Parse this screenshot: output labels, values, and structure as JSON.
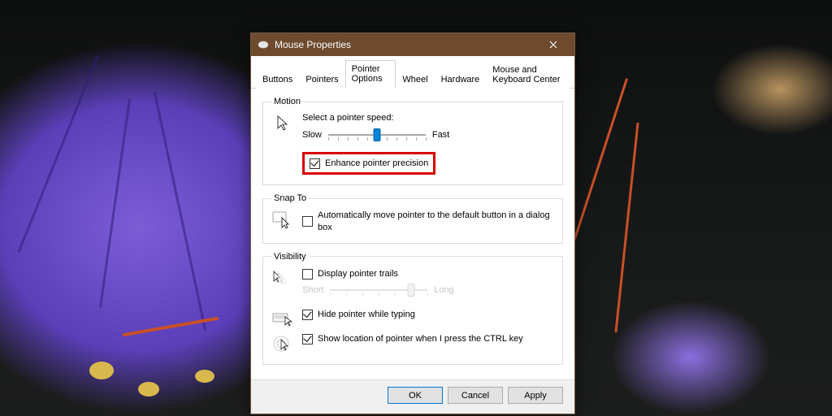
{
  "window": {
    "title": "Mouse Properties"
  },
  "tabs": [
    "Buttons",
    "Pointers",
    "Pointer Options",
    "Wheel",
    "Hardware",
    "Mouse and Keyboard Center"
  ],
  "active_tab_index": 2,
  "motion": {
    "legend": "Motion",
    "speed_label": "Select a pointer speed:",
    "slow": "Slow",
    "fast": "Fast",
    "slider": {
      "min": 1,
      "max": 11,
      "value": 6
    },
    "enhance_label": "Enhance pointer precision",
    "enhance_checked": true
  },
  "snapto": {
    "legend": "Snap To",
    "auto_label": "Automatically move pointer to the default button in a dialog box",
    "auto_checked": false
  },
  "visibility": {
    "legend": "Visibility",
    "trails_label": "Display pointer trails",
    "trails_checked": false,
    "trails_short": "Short",
    "trails_long": "Long",
    "trails_slider": {
      "min": 1,
      "max": 7,
      "value": 6
    },
    "hide_label": "Hide pointer while typing",
    "hide_checked": true,
    "ctrl_label": "Show location of pointer when I press the CTRL key",
    "ctrl_checked": true
  },
  "buttons": {
    "ok": "OK",
    "cancel": "Cancel",
    "apply": "Apply"
  }
}
